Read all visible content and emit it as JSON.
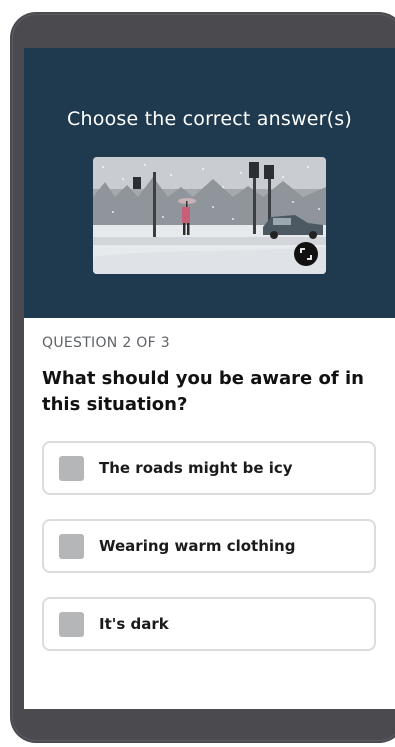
{
  "hero": {
    "title": "Choose the correct answer(s)",
    "image_icon": "snowy-street-photo",
    "expand_icon": "expand-icon"
  },
  "question": {
    "counter": "QUESTION 2 OF 3",
    "text": "What should you be aware of in this situation?"
  },
  "options": [
    {
      "label": "The roads might be icy",
      "checked": false
    },
    {
      "label": "Wearing warm clothing",
      "checked": false
    },
    {
      "label": "It's dark",
      "checked": false
    }
  ],
  "colors": {
    "hero_background": "#1f3a4f",
    "checkbox_unchecked": "#b5b6b8",
    "option_border": "#dadcdf",
    "frame": "#4a4a4f"
  }
}
